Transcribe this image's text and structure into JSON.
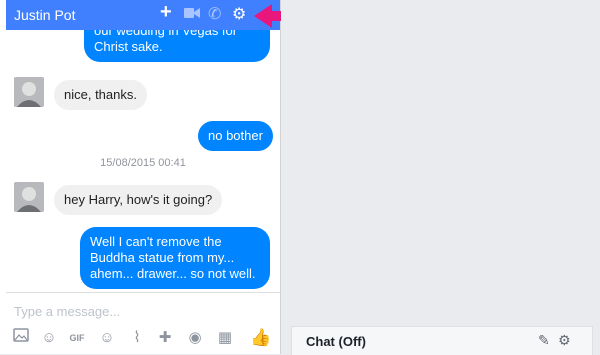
{
  "header": {
    "title": "Justin Pot",
    "icons": {
      "add": "plus-icon",
      "video": "video-camera-icon",
      "call": "phone-icon",
      "settings": "gear-icon"
    }
  },
  "messages": {
    "msg1": "our wedding in Vegas for Christ sake.",
    "msg2": "nice, thanks.",
    "msg3": "no bother",
    "timestamp": "15/08/2015 00:41",
    "msg4": "hey Harry, how's it going?",
    "msg5": "Well I can't remove the Buddha statue from my... ahem... drawer... so not well."
  },
  "composer": {
    "placeholder": "Type a message...",
    "tools": [
      "photo-icon",
      "sticker-icon",
      "gif-icon",
      "emoji-icon",
      "attach-icon",
      "game-icon",
      "camera-icon",
      "calendar-icon",
      "like-icon"
    ]
  },
  "right_panel": {
    "chat_status": "Chat (Off)"
  },
  "colors": {
    "header": "#4080ff",
    "my_bubble": "#0084ff",
    "their_bubble": "#f1f0f0",
    "annotation_arrow": "#e8177d"
  }
}
